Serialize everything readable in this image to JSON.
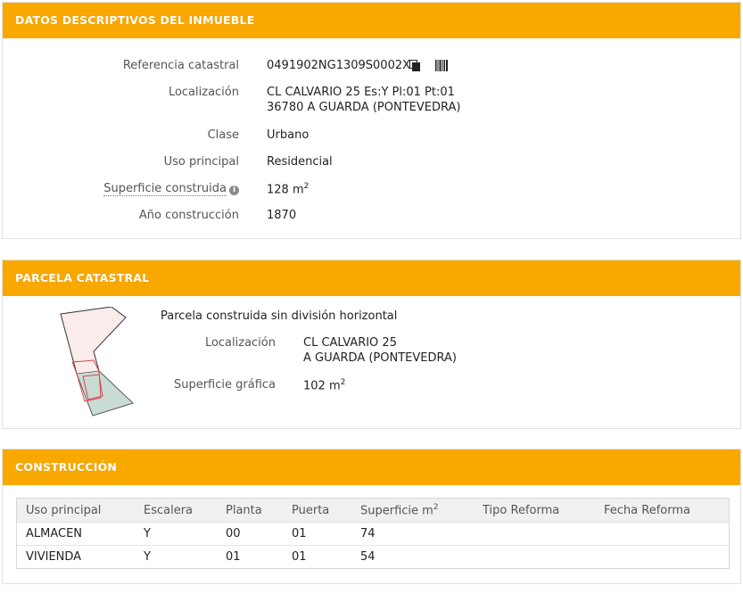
{
  "datos": {
    "header": "DATOS DESCRIPTIVOS DEL INMUEBLE",
    "ref_label": "Referencia catastral",
    "ref_value": "0491902NG1309S0002XT",
    "loc_label": "Localización",
    "loc_line1": "CL CALVARIO 25 Es:Y Pl:01 Pt:01",
    "loc_line2": "36780 A GUARDA (PONTEVEDRA)",
    "clase_label": "Clase",
    "clase_value": "Urbano",
    "uso_label": "Uso principal",
    "uso_value": "Residencial",
    "sup_label": "Superficie construida",
    "sup_value": "128 m",
    "sup_unit_exp": "2",
    "anio_label": "Año construcción",
    "anio_value": "1870",
    "copy_icon": "copy-icon",
    "barcode_icon": "barcode-icon",
    "info_icon": "info-icon"
  },
  "parcela": {
    "header": "PARCELA CATASTRAL",
    "title": "Parcela construida sin división horizontal",
    "loc_label": "Localización",
    "loc_line1": "CL CALVARIO 25",
    "loc_line2": "A GUARDA (PONTEVEDRA)",
    "sup_label": "Superficie gráfica",
    "sup_value": "102 m",
    "sup_unit_exp": "2"
  },
  "construccion": {
    "header": "CONSTRUCCIÓN",
    "columns": [
      "Uso principal",
      "Escalera",
      "Planta",
      "Puerta",
      "Superficie m",
      "Tipo Reforma",
      "Fecha Reforma"
    ],
    "sup_col_exp": "2",
    "rows": [
      [
        "ALMACEN",
        "Y",
        "00",
        "01",
        "74",
        "",
        ""
      ],
      [
        "VIVIENDA",
        "Y",
        "01",
        "01",
        "54",
        "",
        ""
      ]
    ]
  },
  "colors": {
    "header_orange": "#f9a800",
    "parcel_fill": "#fbecec",
    "parcel_stroke": "#333333",
    "unit_outline": "#d9434f",
    "unit_fill": "#c9dcd3"
  }
}
